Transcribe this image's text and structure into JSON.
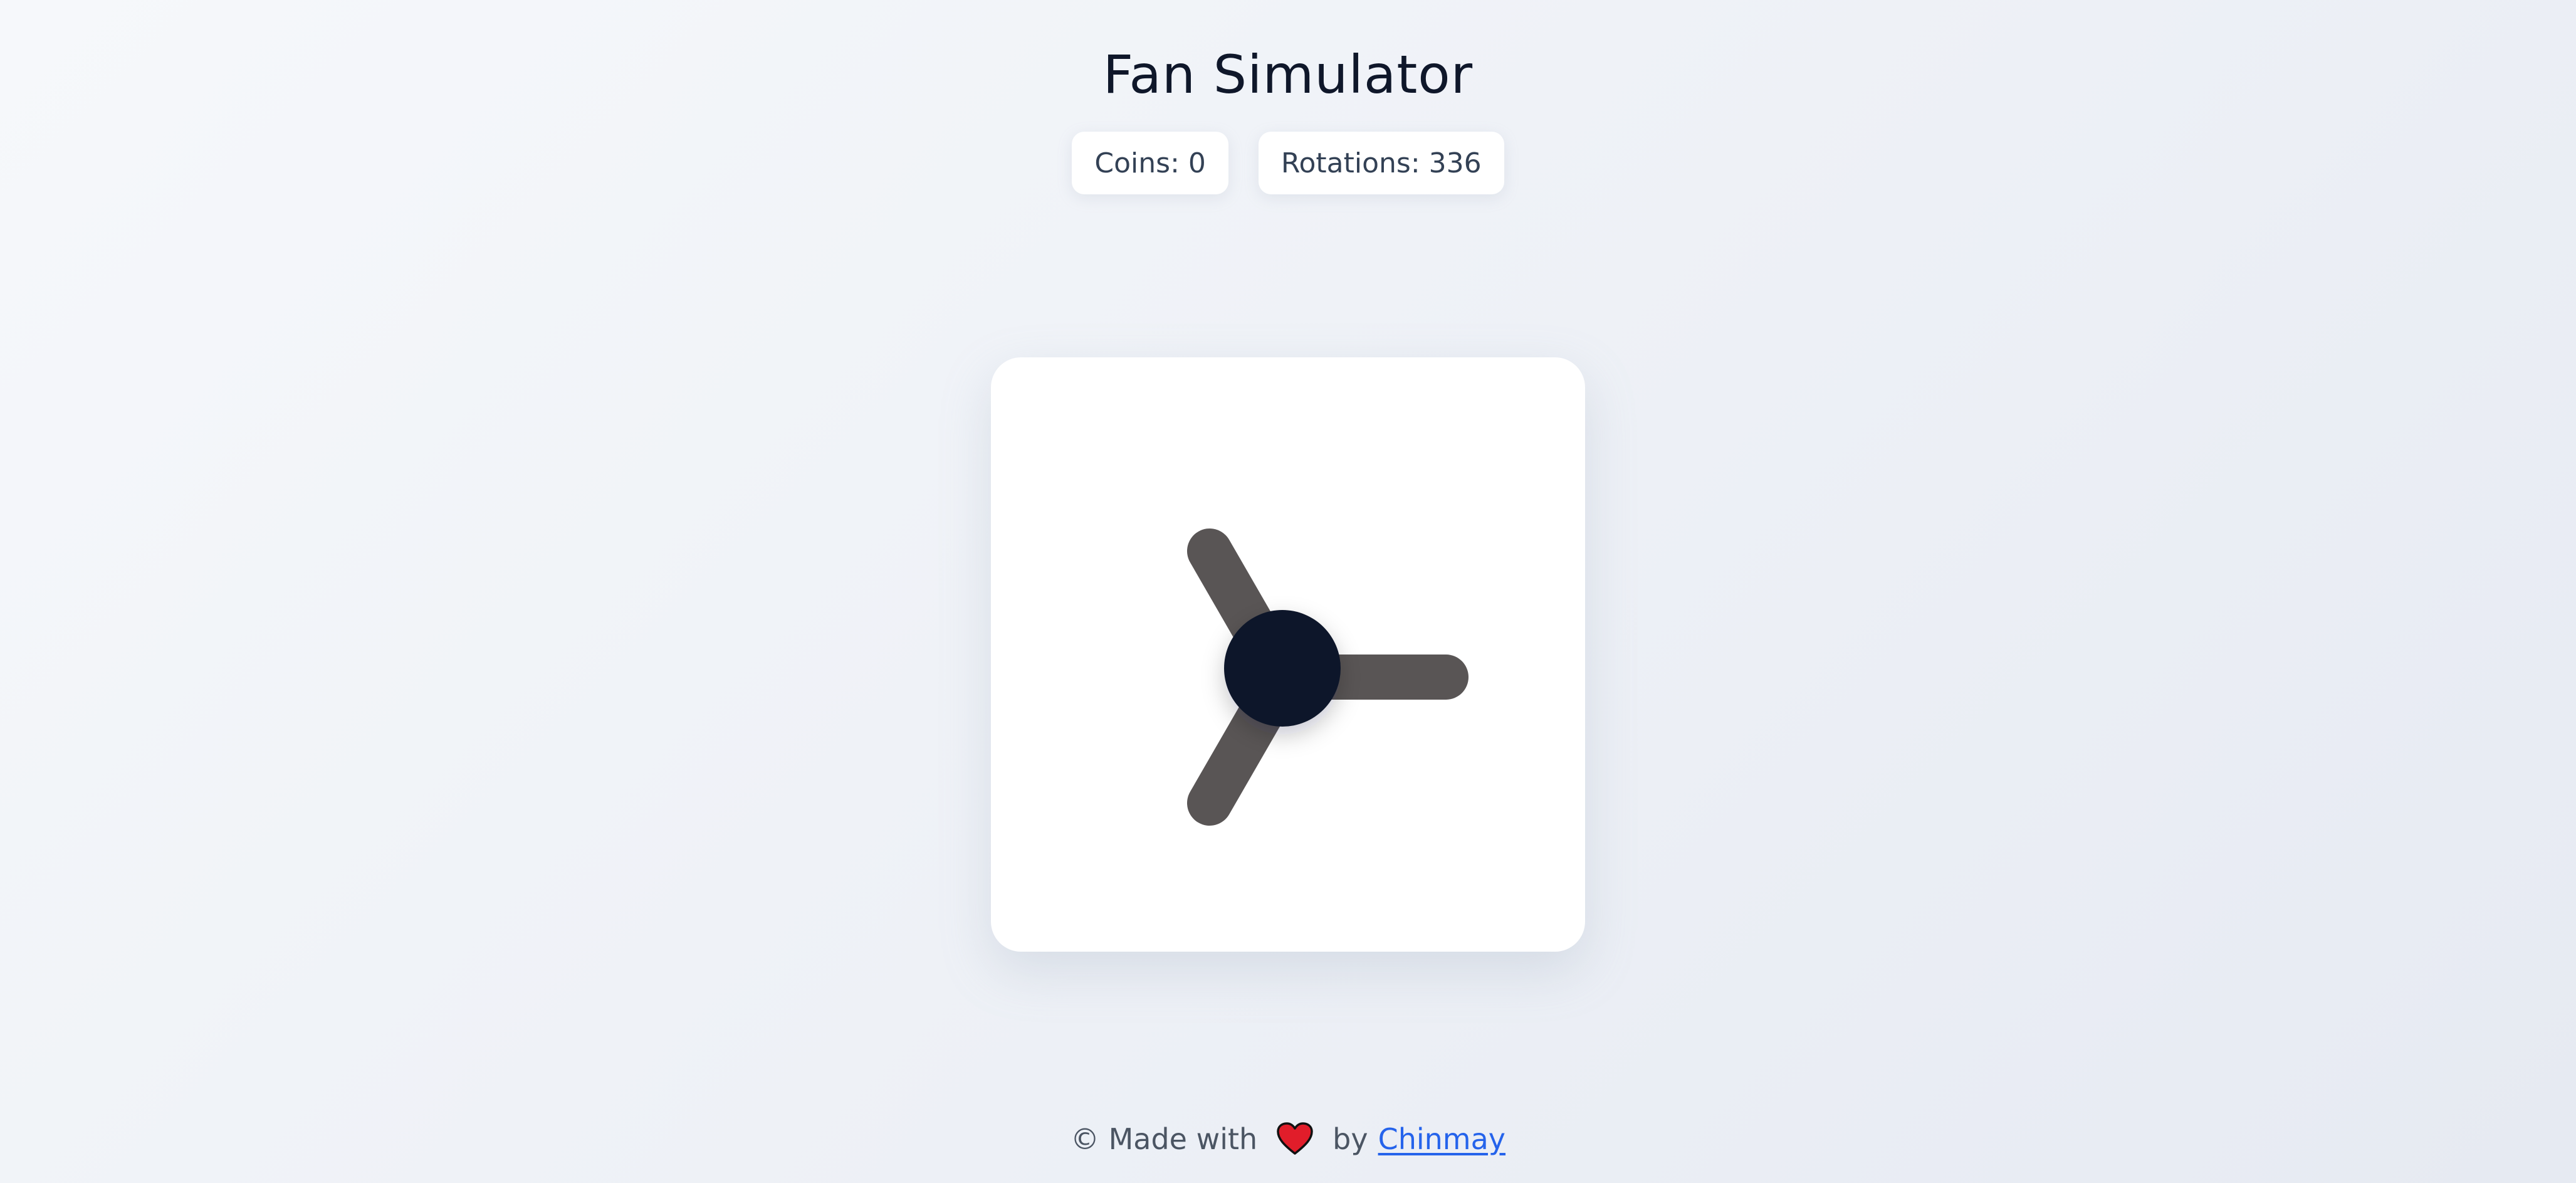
{
  "app": {
    "title": "Fan Simulator"
  },
  "stats": {
    "coins": "Coins: 0",
    "rotations": "Rotations: 336"
  },
  "fan": {
    "blade_color": "#595555",
    "hub_color": "#0f172a",
    "card_color": "#ffffff"
  },
  "footer": {
    "made_with": "© Made with",
    "heart_icon": "heart-icon",
    "heart_color": "#e11d2a",
    "by": "by",
    "author": "Chinmay",
    "link_color": "#2563eb"
  }
}
